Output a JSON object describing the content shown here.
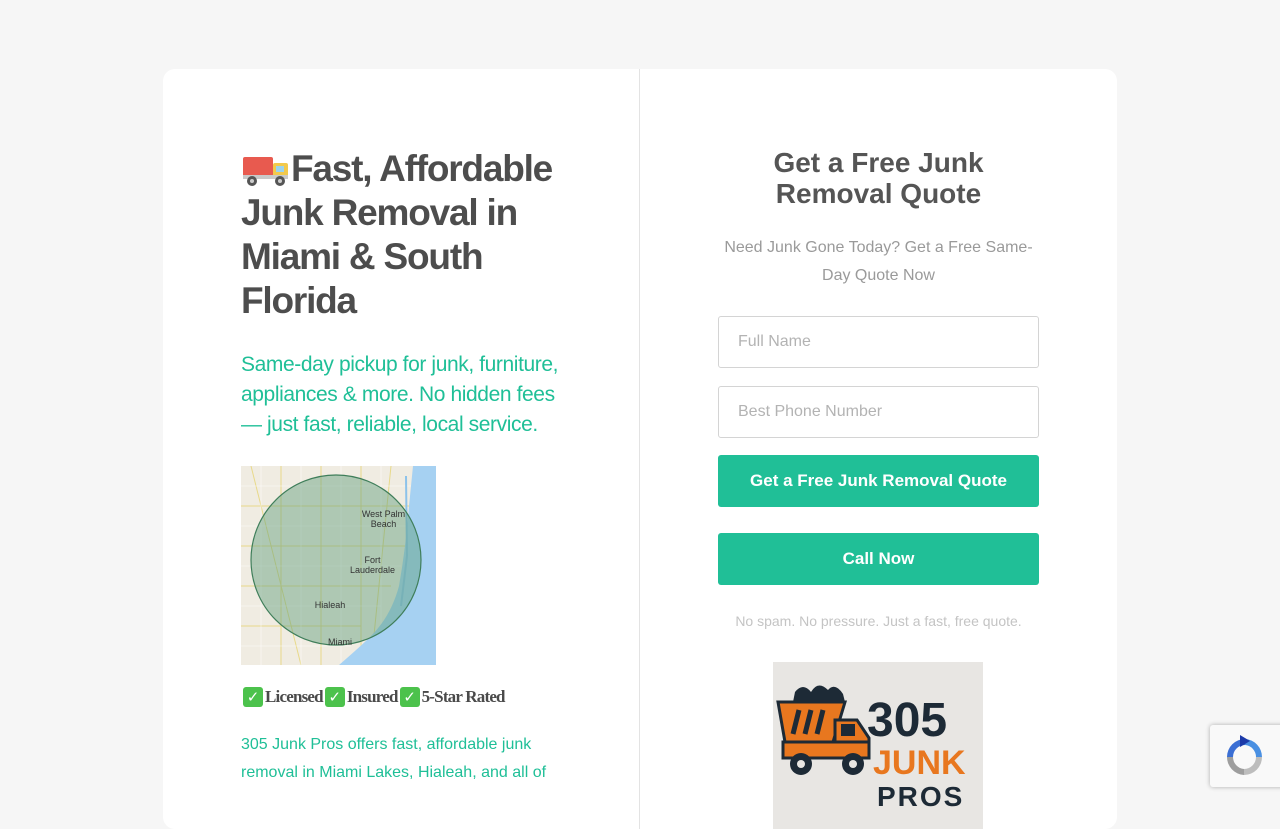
{
  "hero": {
    "truck_icon": "delivery-truck-emoji",
    "headline": "Fast, Affordable Junk Removal in Miami & South Florida",
    "subheadline": "Same-day pickup for junk, furniture, appliances & more. No hidden fees — just fast, reliable, local service."
  },
  "map": {
    "labels": {
      "west_palm_beach": "West Palm Beach",
      "fort_lauderdale": "Fort Lauderdale",
      "hialeah": "Hialeah",
      "miami": "Miami"
    }
  },
  "badges": [
    {
      "icon": "check-mark-icon",
      "label": "Licensed"
    },
    {
      "icon": "check-mark-icon",
      "label": "Insured"
    },
    {
      "icon": "check-mark-icon",
      "label": "5-Star Rated"
    }
  ],
  "blurb": "305 Junk Pros offers fast, affordable junk removal in Miami Lakes, Hialeah, and all of",
  "form": {
    "title": "Get a Free Junk Removal Quote",
    "subtitle": "Need Junk Gone Today? Get a Free Same-Day Quote Now",
    "full_name_placeholder": "Full Name",
    "phone_placeholder": "Best Phone Number",
    "submit_label": "Get a Free Junk Removal Quote",
    "call_label": "Call Now",
    "fine_print": "No spam. No pressure. Just a fast, free quote."
  },
  "logo": {
    "number": "305",
    "word1": "JUNK",
    "word2": "PROS"
  },
  "colors": {
    "accent": "#20bf97",
    "heading": "#4d4d4d",
    "logo_orange": "#e8771f",
    "logo_dark": "#1d2a36"
  }
}
